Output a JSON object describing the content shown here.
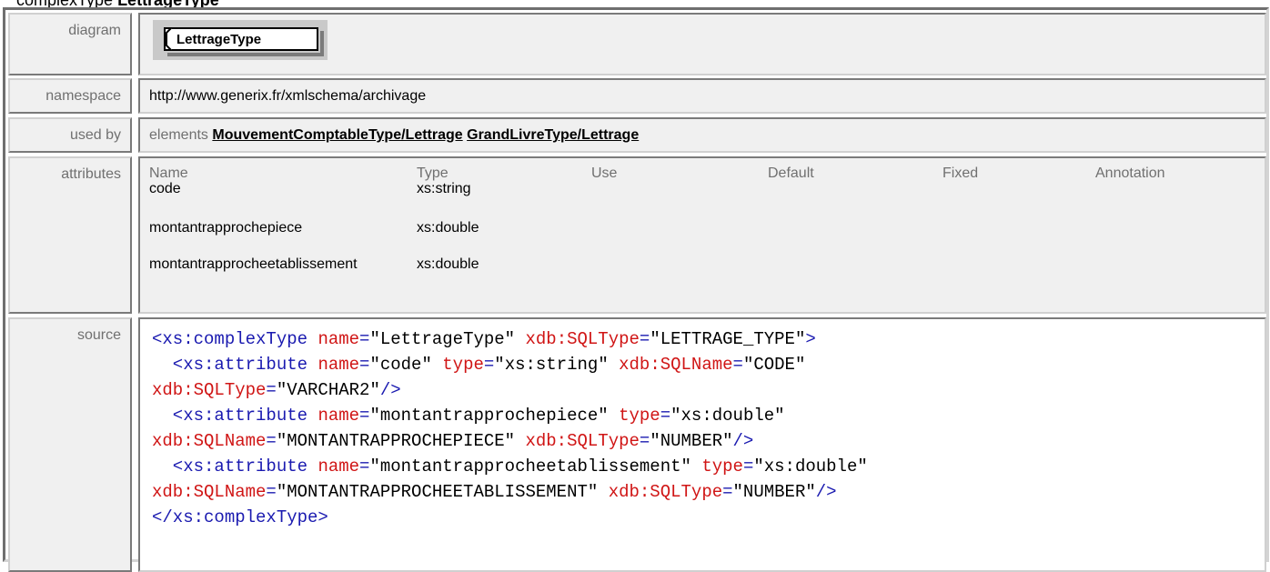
{
  "heading": {
    "prefix": "complexType ",
    "name": "LettrageType"
  },
  "rows": {
    "diagram": {
      "label": "diagram",
      "box_text": "LettrageType"
    },
    "namespace": {
      "label": "namespace",
      "value": "http://www.generix.fr/xmlschema/archivage"
    },
    "used_by": {
      "label": "used by",
      "prefix": "elements",
      "links": [
        "MouvementComptableType/Lettrage",
        "GrandLivreType/Lettrage"
      ]
    },
    "attributes": {
      "label": "attributes",
      "columns": [
        "Name",
        "Type",
        "Use",
        "Default",
        "Fixed",
        "Annotation"
      ],
      "items": [
        {
          "name": "code",
          "type": "xs:string"
        },
        {
          "name": "montantrapprochepiece",
          "type": "xs:double"
        },
        {
          "name": "montantrapprocheetablissement",
          "type": "xs:double"
        }
      ]
    },
    "source": {
      "label": "source",
      "lines": [
        [
          {
            "k": "tag",
            "t": "<xs:complexType "
          },
          {
            "k": "an",
            "t": "name"
          },
          {
            "k": "tag",
            "t": "="
          },
          {
            "k": "av",
            "t": "\"LettrageType\""
          },
          {
            "k": "an",
            "t": " xdb:SQLType"
          },
          {
            "k": "tag",
            "t": "="
          },
          {
            "k": "av",
            "t": "\"LETTRAGE_TYPE\""
          },
          {
            "k": "tag",
            "t": ">"
          }
        ],
        [
          {
            "k": "tag",
            "t": "  <xs:attribute "
          },
          {
            "k": "an",
            "t": "name"
          },
          {
            "k": "tag",
            "t": "="
          },
          {
            "k": "av",
            "t": "\"code\""
          },
          {
            "k": "an",
            "t": " type"
          },
          {
            "k": "tag",
            "t": "="
          },
          {
            "k": "av",
            "t": "\"xs:string\""
          },
          {
            "k": "an",
            "t": " xdb:SQLName"
          },
          {
            "k": "tag",
            "t": "="
          },
          {
            "k": "av",
            "t": "\"CODE\""
          }
        ],
        [
          {
            "k": "an",
            "t": "xdb:SQLType"
          },
          {
            "k": "tag",
            "t": "="
          },
          {
            "k": "av",
            "t": "\"VARCHAR2\""
          },
          {
            "k": "tag",
            "t": "/>"
          }
        ],
        [
          {
            "k": "tag",
            "t": "  <xs:attribute "
          },
          {
            "k": "an",
            "t": "name"
          },
          {
            "k": "tag",
            "t": "="
          },
          {
            "k": "av",
            "t": "\"montantrapprochepiece\""
          },
          {
            "k": "an",
            "t": " type"
          },
          {
            "k": "tag",
            "t": "="
          },
          {
            "k": "av",
            "t": "\"xs:double\""
          }
        ],
        [
          {
            "k": "an",
            "t": "xdb:SQLName"
          },
          {
            "k": "tag",
            "t": "="
          },
          {
            "k": "av",
            "t": "\"MONTANTRAPPROCHEPIECE\""
          },
          {
            "k": "an",
            "t": " xdb:SQLType"
          },
          {
            "k": "tag",
            "t": "="
          },
          {
            "k": "av",
            "t": "\"NUMBER\""
          },
          {
            "k": "tag",
            "t": "/>"
          }
        ],
        [
          {
            "k": "tag",
            "t": "  <xs:attribute "
          },
          {
            "k": "an",
            "t": "name"
          },
          {
            "k": "tag",
            "t": "="
          },
          {
            "k": "av",
            "t": "\"montantrapprocheetablissement\""
          },
          {
            "k": "an",
            "t": " type"
          },
          {
            "k": "tag",
            "t": "="
          },
          {
            "k": "av",
            "t": "\"xs:double\""
          }
        ],
        [
          {
            "k": "an",
            "t": "xdb:SQLName"
          },
          {
            "k": "tag",
            "t": "="
          },
          {
            "k": "av",
            "t": "\"MONTANTRAPPROCHEETABLISSEMENT\""
          },
          {
            "k": "an",
            "t": " xdb:SQLType"
          },
          {
            "k": "tag",
            "t": "="
          },
          {
            "k": "av",
            "t": "\"NUMBER\""
          },
          {
            "k": "tag",
            "t": "/>"
          }
        ],
        [
          {
            "k": "tag",
            "t": "</xs:complexType>"
          }
        ]
      ]
    }
  }
}
